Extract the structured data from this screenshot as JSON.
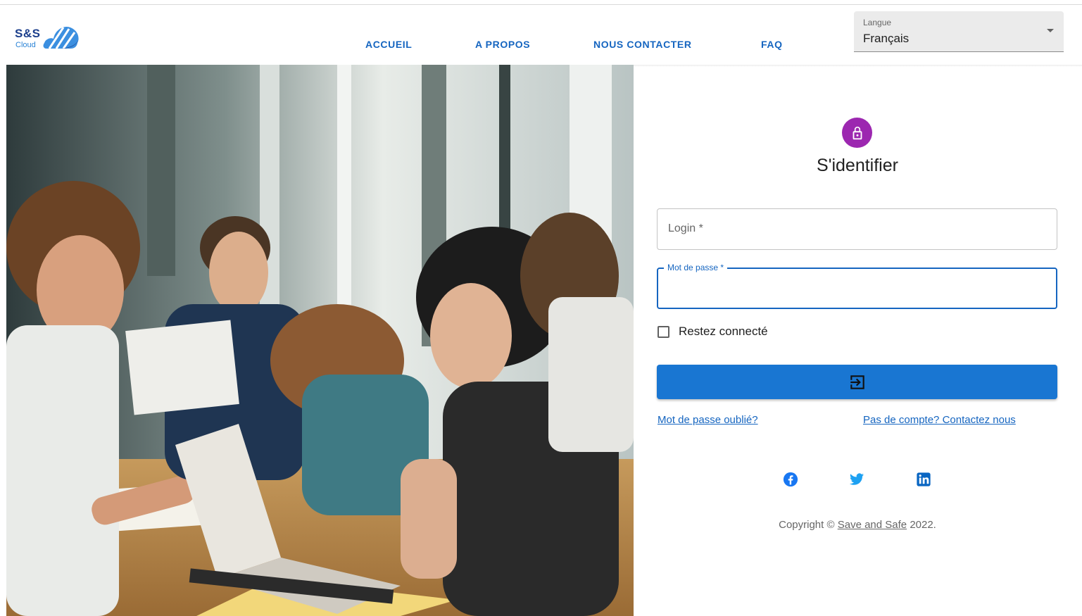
{
  "header": {
    "logo": {
      "brand": "S&S",
      "sub": "Cloud"
    },
    "nav": [
      {
        "label": "ACCUEIL"
      },
      {
        "label": "A PROPOS"
      },
      {
        "label": "NOUS CONTACTER"
      },
      {
        "label": "FAQ"
      }
    ],
    "language": {
      "label": "Langue",
      "value": "Français"
    }
  },
  "login": {
    "title": "S'identifier",
    "login_placeholder": "Login *",
    "password_label": "Mot de passe *",
    "remember_label": "Restez connecté",
    "remember_checked": false,
    "submit_icon": "login-icon",
    "forgot_link": "Mot de passe oublié?",
    "signup_link": "Pas de compte? Contactez nous"
  },
  "social": {
    "icons": [
      "facebook-icon",
      "twitter-icon",
      "linkedin-icon"
    ]
  },
  "footer": {
    "prefix": "Copyright ©",
    "company": "Save and Safe",
    "year": "2022."
  },
  "colors": {
    "primary": "#1976d2",
    "nav_text": "#1565c0",
    "avatar_bg": "#9c27b0",
    "facebook": "#1877f2",
    "twitter": "#1da1f2",
    "linkedin": "#0a66c2"
  }
}
